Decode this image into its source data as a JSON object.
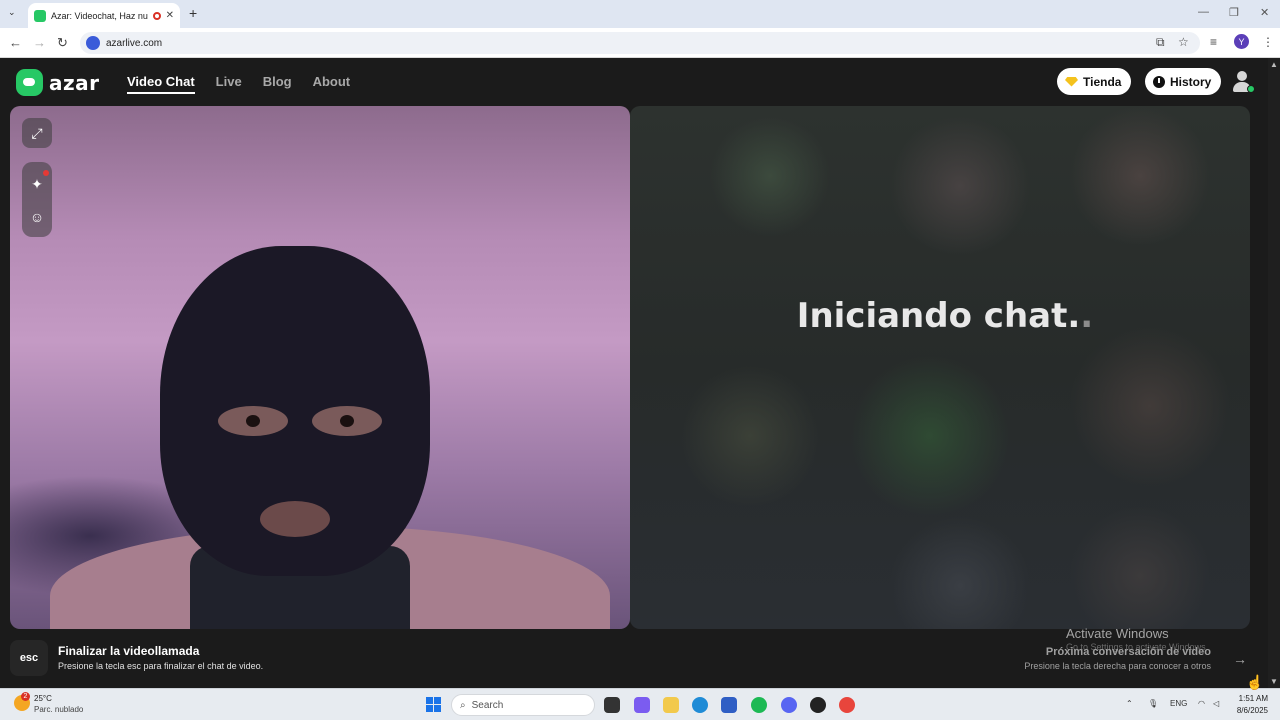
{
  "browser": {
    "tab_title": "Azar: Videochat, Haz nuevo",
    "tab_close": "✕",
    "new_tab": "+",
    "url": "azarlive.com",
    "profile_initial": "Y",
    "nav_back": "←",
    "nav_forward": "→",
    "nav_reload": "↻",
    "tab_list": "⌄",
    "min": "—",
    "restore": "❐",
    "close": "✕"
  },
  "app": {
    "logo_text": "azar",
    "nav": [
      {
        "label": "Video Chat",
        "active": true
      },
      {
        "label": "Live"
      },
      {
        "label": "Blog"
      },
      {
        "label": "About"
      }
    ],
    "store_button": "Tienda",
    "history_button": "History"
  },
  "remote_panel": {
    "status_text": "Iniciando chat.",
    "status_dot": "."
  },
  "bottom": {
    "esc_key": "esc",
    "end_title": "Finalizar la videollamada",
    "end_subtitle": "Presione la tecla esc para finalizar el chat de video.",
    "next_title": "Próxima conversación de video",
    "next_subtitle": "Presione la tecla derecha para conocer a otros",
    "next_arrow": "→",
    "activate_title": "Activate Windows",
    "activate_subtitle": "Go to Settings to activate Windows."
  },
  "taskbar": {
    "weather_badge": "2",
    "temperature": "25°C",
    "weather_desc": "Parc. nublado",
    "search_placeholder": "Search",
    "language": "ENG",
    "time": "1:51 AM",
    "date": "8/6/2025"
  },
  "colors": {
    "brand_green": "#27c865",
    "background": "#1b1b1b",
    "gem_yellow": "#f4c21d"
  },
  "icons": [
    "expand-icon",
    "sparkle-effects-icon",
    "sticker-face-icon",
    "diamond-icon",
    "clock-icon",
    "user-avatar-icon",
    "arrow-right-icon"
  ]
}
